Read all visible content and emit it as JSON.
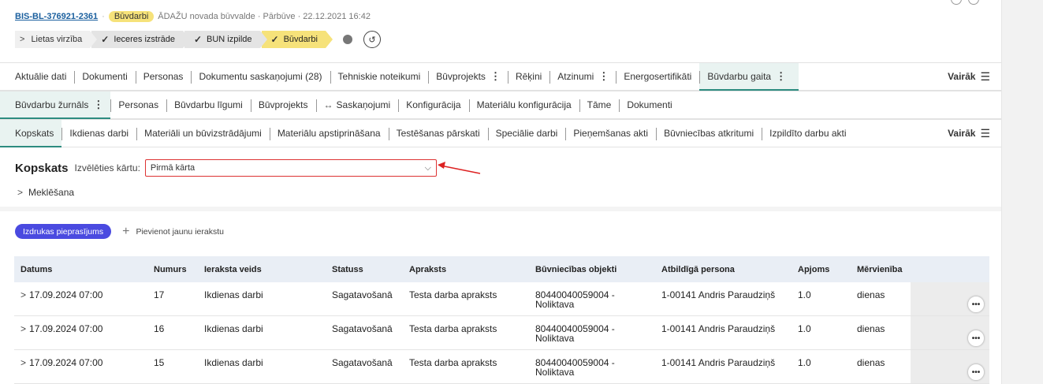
{
  "header": {
    "case_id": "BIS-BL-376921-2361",
    "stage_badge": "Būvdarbi",
    "details": "ĀDAŽU novada būvvalde · Pārbūve · 22.12.2021 16:42"
  },
  "progress": {
    "first_step": "Lietas virzība",
    "steps": [
      {
        "label": "Ieceres izstrāde",
        "state": "done"
      },
      {
        "label": "BUN izpilde",
        "state": "done"
      },
      {
        "label": "Būvdarbi",
        "state": "current"
      }
    ]
  },
  "tabs_main": {
    "items": [
      "Aktuālie dati",
      "Dokumenti",
      "Personas",
      "Dokumentu saskaņojumi (28)",
      "Tehniskie noteikumi",
      "Būvprojekts",
      "Rēķini",
      "Atzinumi",
      "Energosertifikāti",
      "Būvdarbu gaita"
    ],
    "more_label": "Vairāk"
  },
  "tabs_journal": {
    "items": [
      "Būvdarbu žurnāls",
      "Personas",
      "Būvdarbu līgumi",
      "Būvprojekts",
      "Saskaņojumi",
      "Konfigurācija",
      "Materiālu konfigurācija",
      "Tāme",
      "Dokumenti"
    ]
  },
  "tabs_sub": {
    "items": [
      "Kopskats",
      "Ikdienas darbi",
      "Materiāli un būvizstrādājumi",
      "Materiālu apstiprināšana",
      "Testēšanas pārskati",
      "Speciālie darbi",
      "Pieņemšanas akti",
      "Būvniecības atkritumi",
      "Izpildīto darbu akti"
    ],
    "more_label": "Vairāk"
  },
  "summary": {
    "title": "Kopskats",
    "select_label": "Izvēlēties kārtu:",
    "select_value": "Pirmā kārta",
    "search_label": "Meklēšana"
  },
  "actions": {
    "print_label": "Izdrukas pieprasījums",
    "add_label": "Pievienot jaunu ierakstu"
  },
  "table": {
    "headers": {
      "date": "Datums",
      "num": "Numurs",
      "type": "Ieraksta veids",
      "status": "Statuss",
      "desc": "Apraksts",
      "obj": "Būvniecības objekti",
      "person": "Atbildīgā persona",
      "qty": "Apjoms",
      "unit": "Mērvienība"
    },
    "rows": [
      {
        "date": "17.09.2024 07:00",
        "num": "17",
        "type": "Ikdienas darbi",
        "status": "Sagatavošanā",
        "desc": "Testa darba apraksts",
        "obj_line1": "80440040059004 -",
        "obj_line2": "Noliktava",
        "person": "1-00141 Andris Paraudziņš",
        "qty": "1.0",
        "unit": "dienas"
      },
      {
        "date": "17.09.2024 07:00",
        "num": "16",
        "type": "Ikdienas darbi",
        "status": "Sagatavošanā",
        "desc": "Testa darba apraksts",
        "obj_line1": "80440040059004 -",
        "obj_line2": "Noliktava",
        "person": "1-00141 Andris Paraudziņš",
        "qty": "1.0",
        "unit": "dienas"
      },
      {
        "date": "17.09.2024 07:00",
        "num": "15",
        "type": "Ikdienas darbi",
        "status": "Sagatavošanā",
        "desc": "Testa darba apraksts",
        "obj_line1": "80440040059004 -",
        "obj_line2": "Noliktava",
        "person": "1-00141 Andris Paraudziņš",
        "qty": "1.0",
        "unit": "dienas"
      }
    ]
  }
}
